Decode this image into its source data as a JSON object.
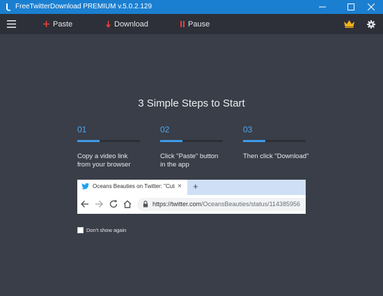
{
  "window": {
    "title": "FreeTwitterDownload PREMIUM  v.5.0.2.129"
  },
  "toolbar": {
    "paste_label": "Paste",
    "download_label": "Download",
    "pause_label": "Pause",
    "accent_red": "#e8403a",
    "crown_color": "#f2b01c"
  },
  "main": {
    "heading": "3 Simple Steps to Start",
    "steps": [
      {
        "number": "01",
        "line1": "Copy a video link",
        "line2": "from your browser",
        "progress": 0.35
      },
      {
        "number": "02",
        "line1": "Click \"Paste\" button",
        "line2": "in the app",
        "progress": 0.35
      },
      {
        "number": "03",
        "line1": "Then click \"Download\"",
        "line2": "",
        "progress": 0.35
      }
    ],
    "browser": {
      "tab_title": "Oceans Beauties on Twitter: \"Cute",
      "tab_close": "×",
      "new_tab": "+",
      "url_prefix": "https://twitter.com",
      "url_path": "/OceansBeauties/status/114385956"
    },
    "dont_show_label": "Don't show again"
  },
  "colors": {
    "titlebar": "#1b7fd1",
    "background": "#3a3e48",
    "step_accent": "#4da8f0"
  }
}
